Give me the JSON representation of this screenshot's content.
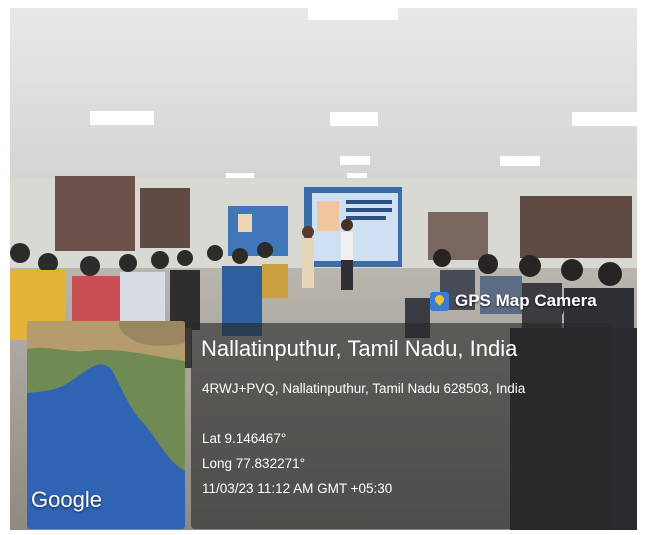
{
  "photo": {
    "watermark": "GPS Map Camera",
    "map_label": "Google",
    "location": {
      "place": "Nallatinputhur, Tamil Nadu, India",
      "address": "4RWJ+PVQ, Nallatinputhur, Tamil Nadu 628503, India",
      "lat": "Lat 9.146467°",
      "long": "Long 77.832271°",
      "datetime": "11/03/23 11:12 AM GMT +05:30"
    }
  }
}
